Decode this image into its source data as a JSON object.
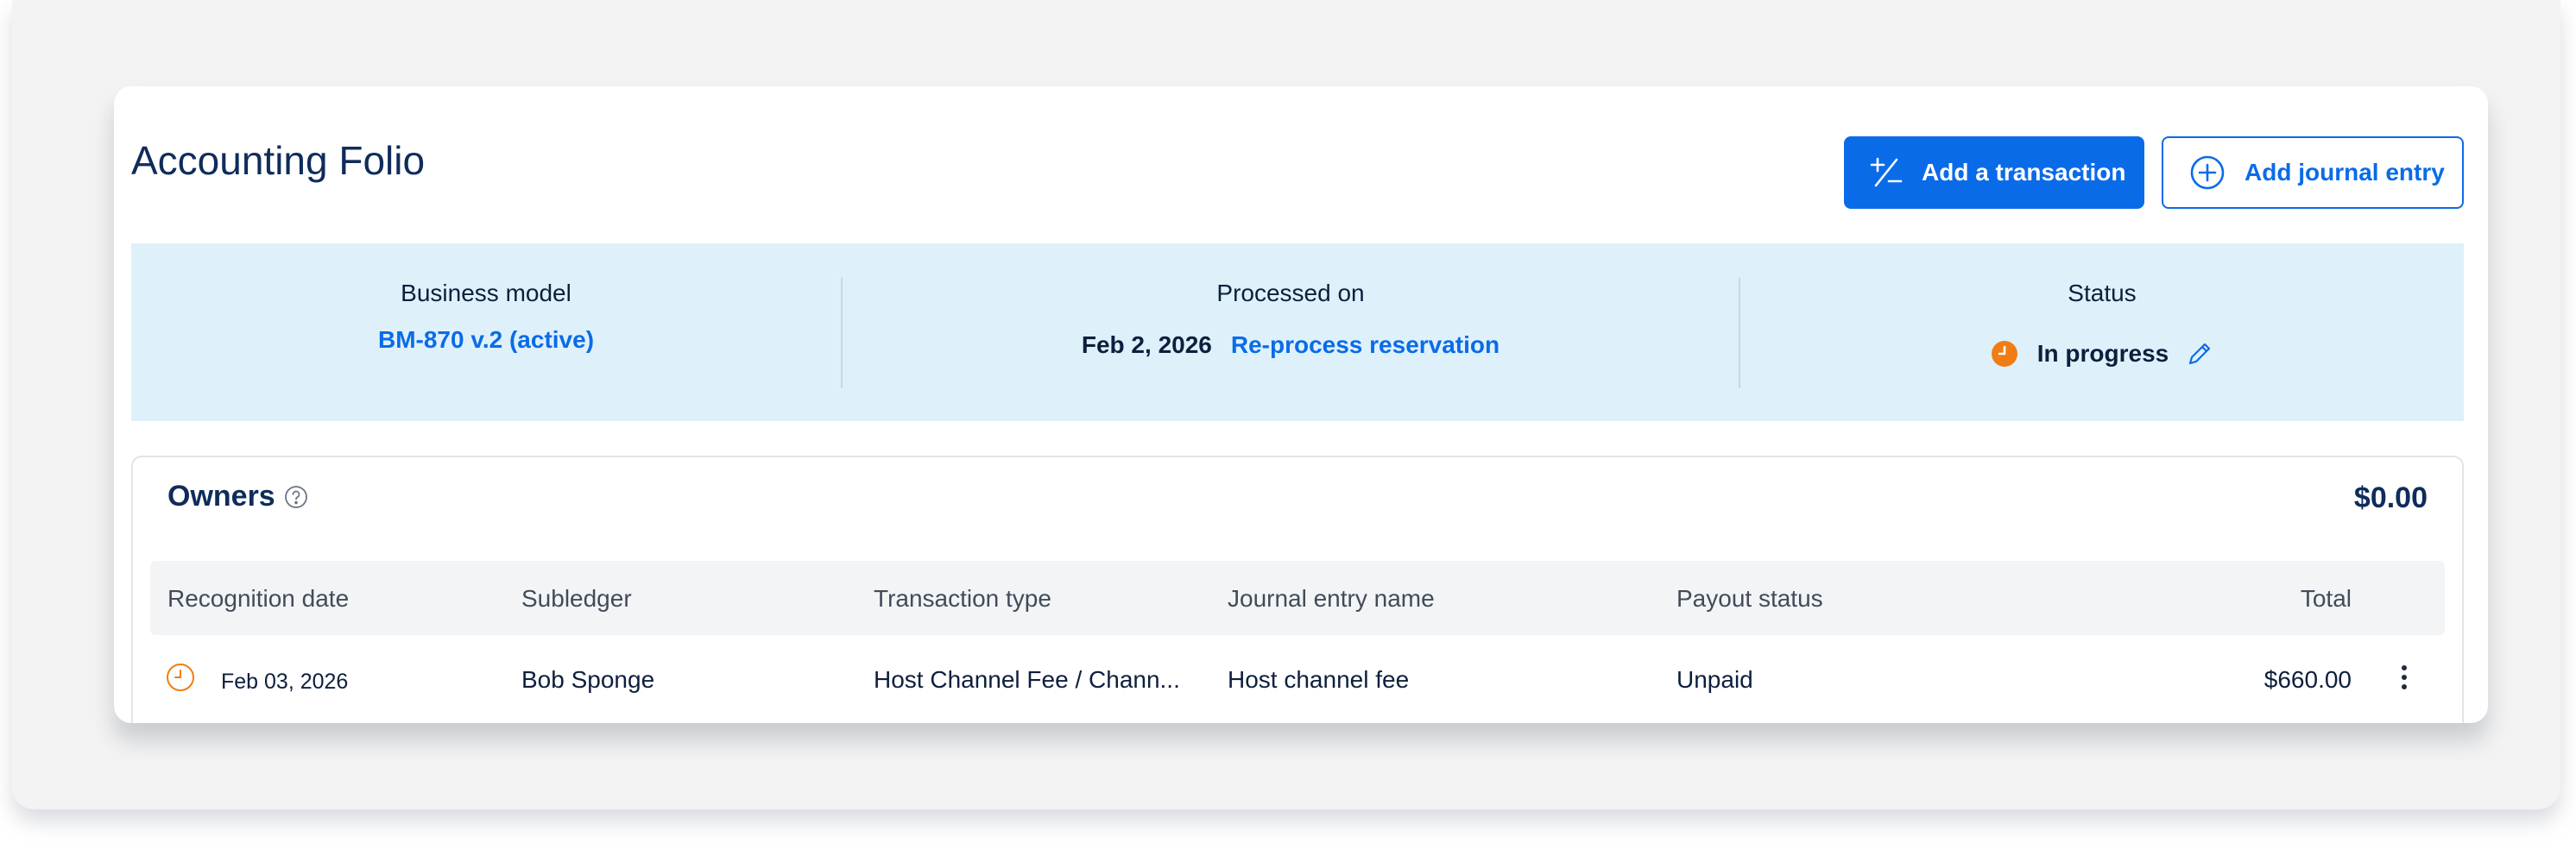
{
  "header": {
    "title": "Accounting Folio",
    "add_transaction_label": "Add a transaction",
    "add_journal_label": "Add journal entry"
  },
  "summary": {
    "business_model_label": "Business model",
    "business_model_value": "BM-870 v.2 (active)",
    "processed_label": "Processed on",
    "processed_date": "Feb 2, 2026",
    "reprocess_link": "Re-process reservation",
    "status_label": "Status",
    "status_value": "In progress"
  },
  "owners": {
    "title": "Owners",
    "total": "$0.00",
    "columns": [
      "Recognition date",
      "Subledger",
      "Transaction type",
      "Journal entry name",
      "Payout status",
      "Total"
    ],
    "rows": [
      {
        "recognition_date": "Feb 03, 2026",
        "subledger": "Bob Sponge",
        "transaction_type": "Host Channel Fee / Chann...",
        "journal_entry_name": "Host channel fee",
        "payout_status": "Unpaid",
        "total": "$660.00"
      }
    ]
  },
  "colors": {
    "accent": "#0a6be8",
    "summary_bg": "#def1fb",
    "status_orange": "#f07d14",
    "title_navy": "#0f2c5b"
  },
  "icons": {
    "add_transaction": "plus-minus-icon",
    "add_journal": "plus-circle-icon",
    "status": "clock-filled-icon",
    "edit": "pencil-icon",
    "help": "question-circle-icon",
    "row_status": "clock-outline-icon",
    "row_menu": "kebab-menu-icon"
  }
}
